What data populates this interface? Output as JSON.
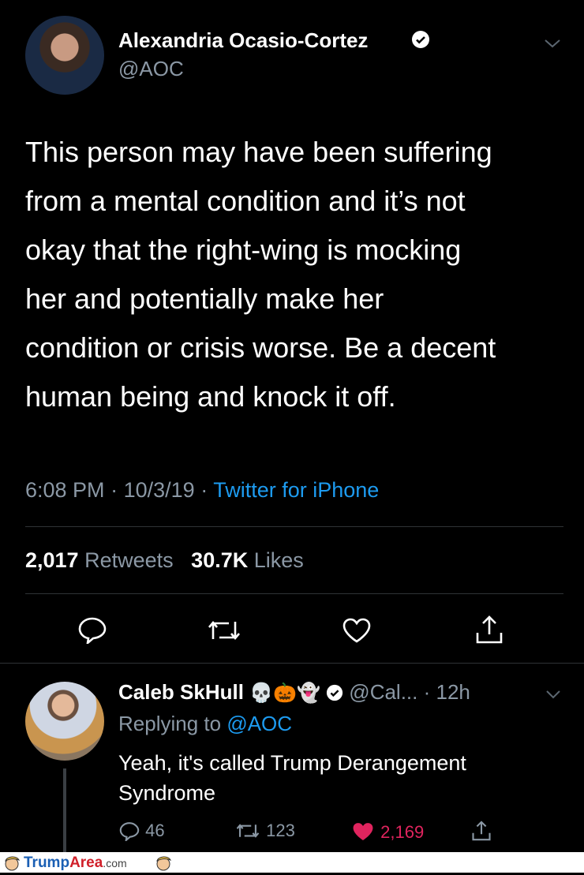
{
  "tweet": {
    "author_name": "Alexandria Ocasio-Cortez",
    "author_handle": "@AOC",
    "lines": [
      "This person may have been suffering",
      "from a mental condition and it’s not",
      "okay that the right-wing is mocking",
      "her and potentially make her",
      "condition or crisis worse. Be a decent",
      "human being and knock it off."
    ],
    "time": "6:08 PM",
    "date": "10/3/19",
    "sep": "·",
    "source": "Twitter for iPhone",
    "retweets_count": "2,017",
    "retweets_label": "Retweets",
    "likes_count": "30.7K",
    "likes_label": "Likes"
  },
  "reply": {
    "author_name": "Caleb SkHull",
    "emojis": "💀🎃👻",
    "handle": "@Cal...",
    "age": "· 12h",
    "replying_prefix": "Replying to",
    "replying_handle": "@AOC",
    "lines": [
      "Yeah, it's called Trump Derangement",
      "Syndrome"
    ],
    "reply_count": "46",
    "retweet_count": "123",
    "like_count": "2,169",
    "like_color": "#e0245e"
  },
  "footer": {
    "brand_trump": "Trump",
    "brand_area": "Area",
    "brand_com": ".com"
  }
}
